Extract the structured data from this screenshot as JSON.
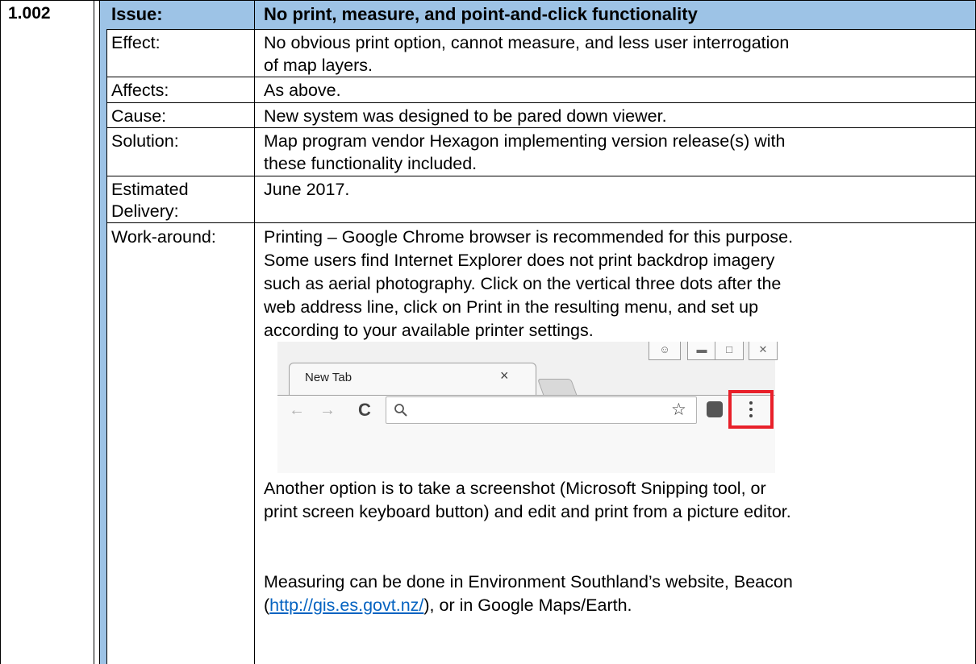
{
  "item": {
    "number": "1.002",
    "issue_label": "Issue:",
    "issue_title": "No print, measure, and point-and-click functionality"
  },
  "rows": {
    "effect": {
      "label": "Effect:",
      "lines": [
        "No obvious print option, cannot measure, and less user interrogation",
        "of map layers."
      ]
    },
    "affects": {
      "label": "Affects:",
      "lines": [
        "As above."
      ]
    },
    "cause": {
      "label": "Cause:",
      "lines": [
        "New system was designed to be pared down viewer."
      ]
    },
    "solution": {
      "label": "Solution:",
      "lines": [
        "Map program vendor Hexagon implementing version release(s) with",
        "these functionality included."
      ]
    },
    "delivery": {
      "label_lines": [
        "Estimated",
        "Delivery:"
      ],
      "lines": [
        "June 2017."
      ]
    },
    "workaround": {
      "label": "Work-around:",
      "lines": [
        "Printing – Google Chrome browser is recommended for this purpose.",
        "Some users find Internet Explorer does not print backdrop imagery",
        "such as aerial photography. Click on the vertical three dots after the",
        "web address line, click on Print in the resulting menu, and set up",
        "according to your available printer settings."
      ],
      "after_lines": [
        "Another option is to take a screenshot (Microsoft Snipping tool, or",
        "print screen keyboard button) and edit and print from a picture editor."
      ],
      "measure_line1": "Measuring can be done in Environment Southland’s website, Beacon",
      "measure_open": "(",
      "measure_link": "http://gis.es.govt.nz/",
      "measure_rest": "), or in Google Maps/Earth."
    }
  },
  "browser": {
    "tab_title": "New Tab",
    "tab_close": "×",
    "back": "←",
    "forward": "→",
    "reload": "C",
    "search_icon": "search-icon",
    "star": "☆",
    "menu_dots": "⋮",
    "accent_color": "#e8202a"
  },
  "colors": {
    "header_blue": "#9dc3e6",
    "link": "#0563c1"
  }
}
